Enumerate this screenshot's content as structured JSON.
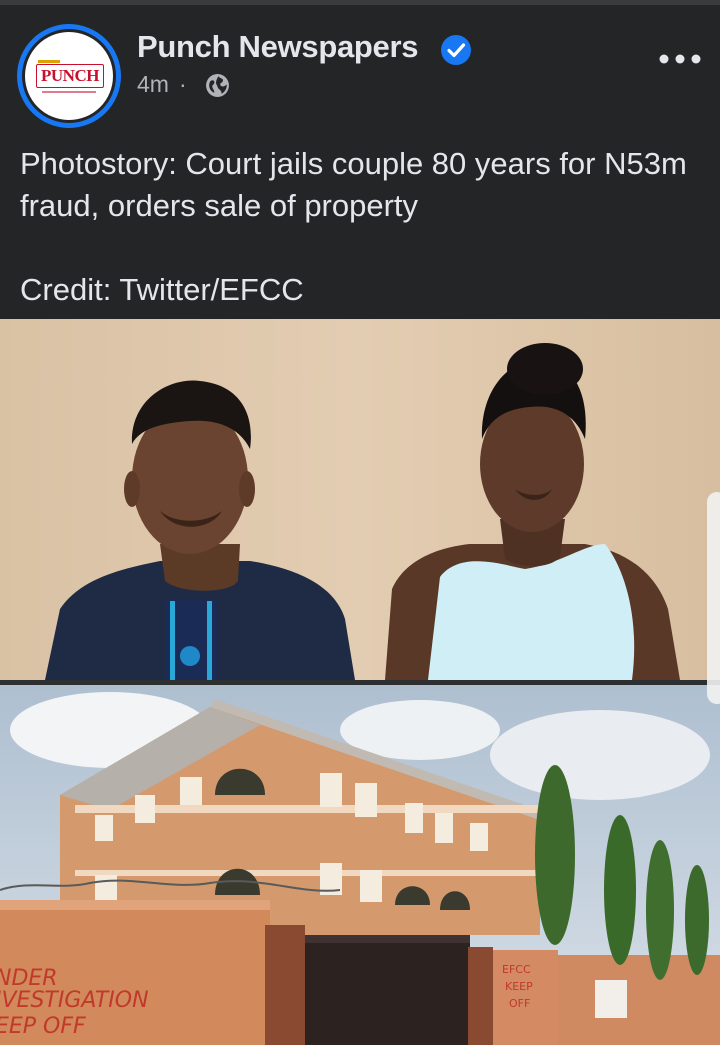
{
  "post": {
    "page_name": "Punch Newspapers",
    "timestamp": "4m",
    "separator": "·",
    "privacy_icon": "globe-icon",
    "verified_icon": "verified-badge-icon",
    "more_icon": "more-options-icon",
    "avatar": {
      "logo_text": "PUNCH"
    },
    "text_line1": "Photostory: Court jails couple 80 years for N53m fraud, orders sale of property",
    "text_credit": "Credit: Twitter/EFCC"
  },
  "photos": {
    "top": {
      "subject": "couple-portrait"
    },
    "bottom": {
      "subject": "building-with-gate",
      "graffiti_lines": [
        "NDER",
        "IVESTIGATION",
        "EEP OFF"
      ],
      "gate_lines": [
        "EFCC",
        "KEEP",
        "OFF"
      ]
    }
  },
  "colors": {
    "background": "#242526",
    "text_primary": "#e4e6eb",
    "text_secondary": "#b0b3b8",
    "accent_blue": "#1877f2",
    "punch_red": "#c8102e"
  }
}
